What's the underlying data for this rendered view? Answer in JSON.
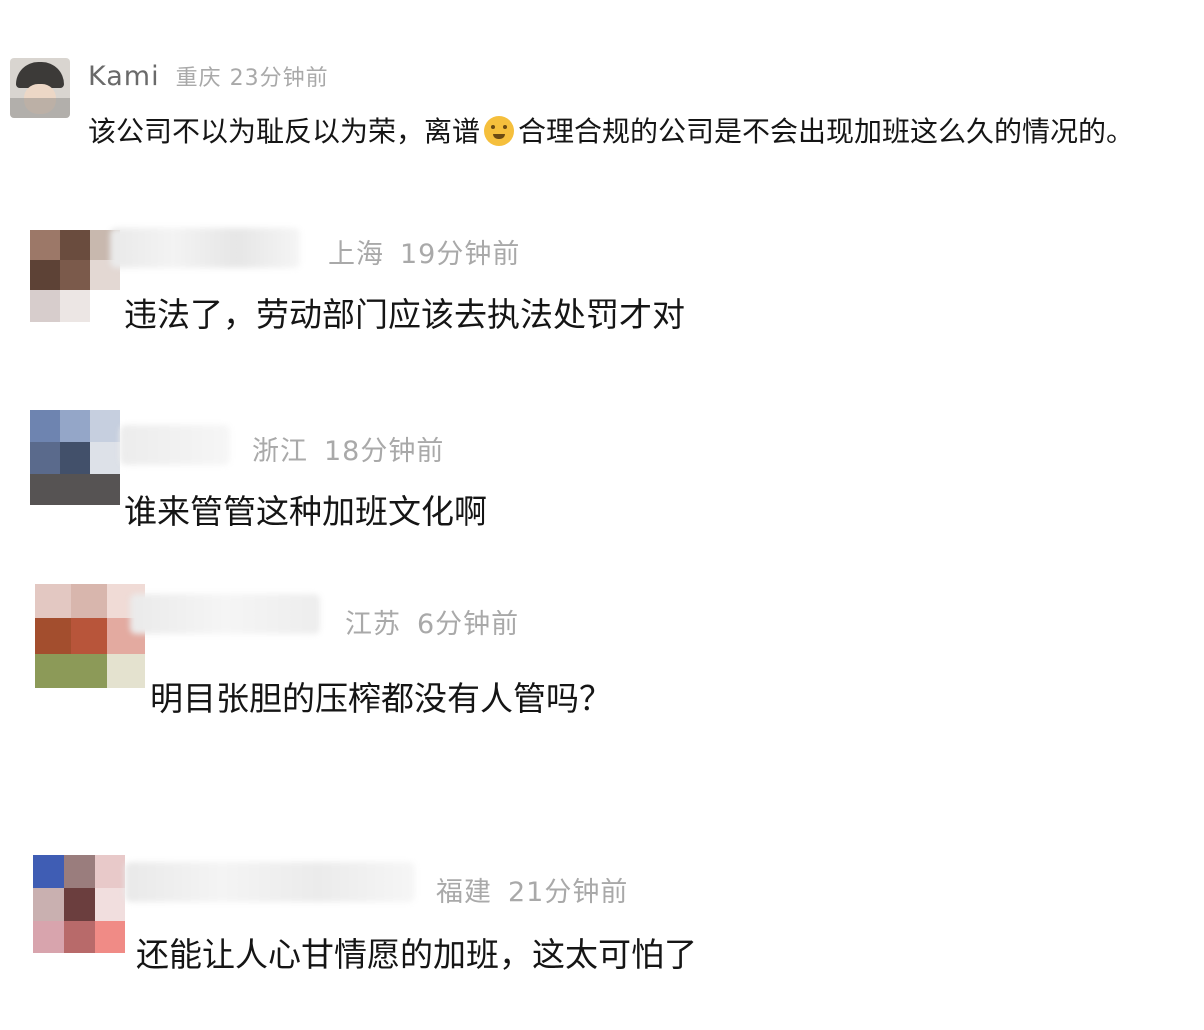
{
  "comments": [
    {
      "username": "Kami",
      "location": "重庆",
      "time": "23分钟前",
      "text_before_emoji": "该公司不以为耻反以为荣，离谱",
      "emoji": "smiling-face-emoji",
      "text_after_emoji": "合理合规的公司是不会出现加班这么久的情况的。"
    },
    {
      "location": "上海",
      "time": "19分钟前",
      "text": "违法了，劳动部门应该去执法处罚才对"
    },
    {
      "location": "浙江",
      "time": "18分钟前",
      "text": "谁来管管这种加班文化啊"
    },
    {
      "location": "江苏",
      "time": "6分钟前",
      "text": "明目张胆的压榨都没有人管吗？"
    },
    {
      "location": "福建",
      "time": "21分钟前",
      "text": "还能让人心甘情愿的加班，这太可怕了"
    }
  ]
}
